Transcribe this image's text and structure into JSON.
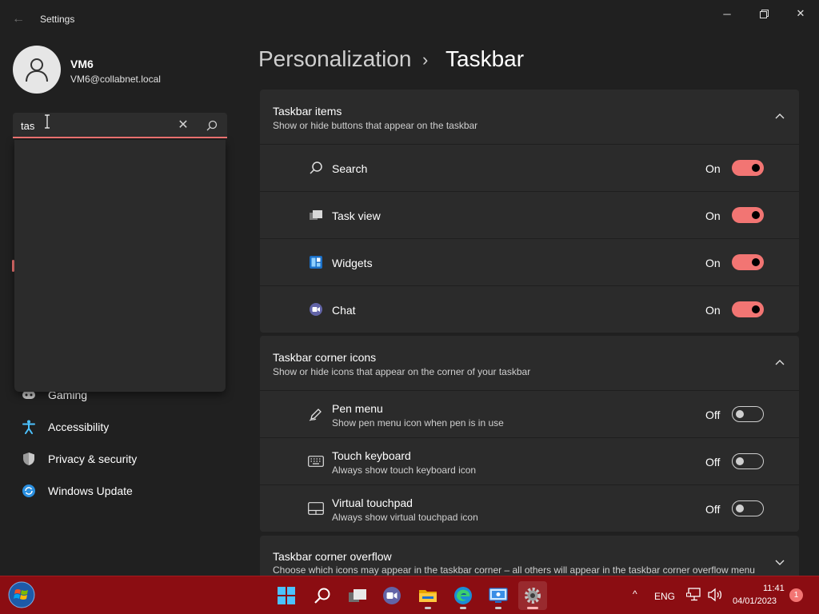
{
  "window": {
    "title": "Settings",
    "back_label": "←",
    "minimize_label": "─",
    "close_label": "✕"
  },
  "user": {
    "name": "VM6",
    "email": "VM6@collabnet.local"
  },
  "search": {
    "value": "tas",
    "clear_label": "✕"
  },
  "nav": {
    "items": [
      {
        "label": "Gaming",
        "icon": "gamepad-icon"
      },
      {
        "label": "Accessibility",
        "icon": "accessibility-icon"
      },
      {
        "label": "Privacy & security",
        "icon": "shield-icon"
      },
      {
        "label": "Windows Update",
        "icon": "update-icon"
      }
    ]
  },
  "breadcrumb": {
    "parent": "Personalization",
    "separator": "›",
    "current": "Taskbar"
  },
  "sections": {
    "taskbar_items": {
      "title": "Taskbar items",
      "subtitle": "Show or hide buttons that appear on the taskbar",
      "rows": [
        {
          "label": "Search",
          "state": "On",
          "icon": "search-icon"
        },
        {
          "label": "Task view",
          "state": "On",
          "icon": "task-view-icon"
        },
        {
          "label": "Widgets",
          "state": "On",
          "icon": "widgets-icon"
        },
        {
          "label": "Chat",
          "state": "On",
          "icon": "chat-icon"
        }
      ]
    },
    "corner_icons": {
      "title": "Taskbar corner icons",
      "subtitle": "Show or hide icons that appear on the corner of your taskbar",
      "rows": [
        {
          "label": "Pen menu",
          "description": "Show pen menu icon when pen is in use",
          "state": "Off",
          "icon": "pen-icon"
        },
        {
          "label": "Touch keyboard",
          "description": "Always show touch keyboard icon",
          "state": "Off",
          "icon": "keyboard-icon"
        },
        {
          "label": "Virtual touchpad",
          "description": "Always show virtual touchpad icon",
          "state": "Off",
          "icon": "touchpad-icon"
        }
      ]
    },
    "corner_overflow": {
      "title": "Taskbar corner overflow",
      "subtitle": "Choose which icons may appear in the taskbar corner – all others will appear in the taskbar corner overflow menu"
    }
  },
  "taskbar": {
    "tray_language": "ENG",
    "tray_chevron": "^",
    "clock_time": "11:41",
    "clock_date": "04/01/2023",
    "notification_count": "1"
  },
  "colors": {
    "accent": "#f27573",
    "background": "#202020",
    "card": "#2b2b2b",
    "taskbar": "#8b0d12"
  }
}
